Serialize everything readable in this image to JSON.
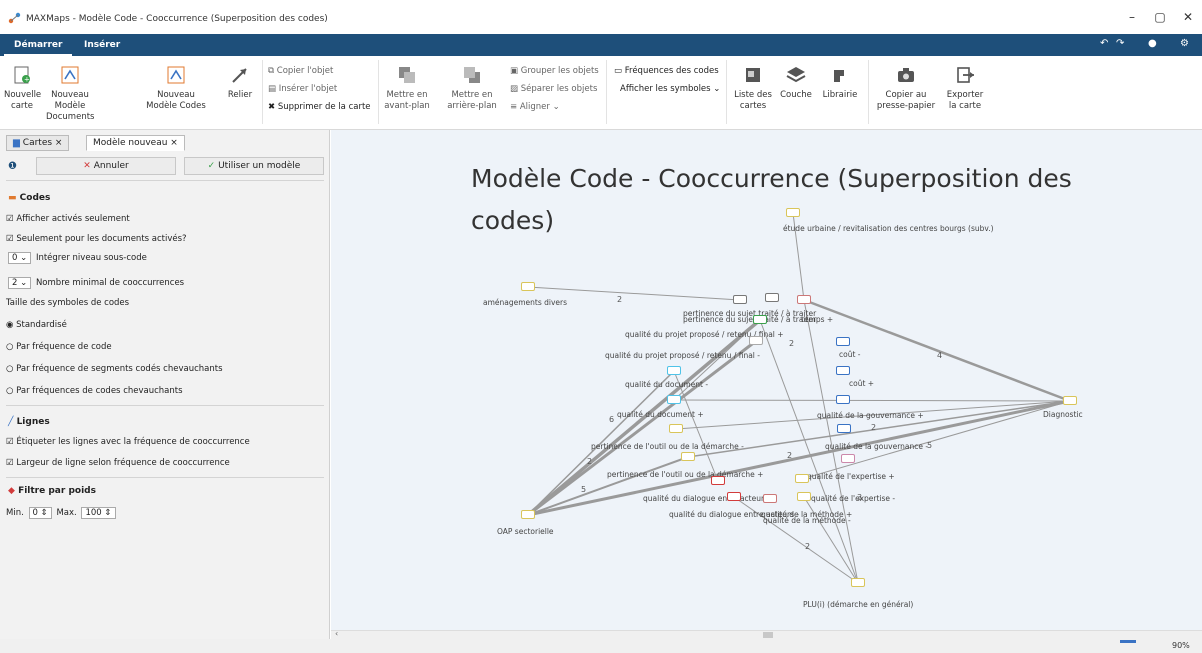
{
  "window": {
    "title": "MAXMaps - Modèle Code - Cooccurrence (Superposition des codes)",
    "minimize": "–",
    "maximize": "▢",
    "close": "✕"
  },
  "ribbon_tabs": [
    "Démarrer",
    "Insérer"
  ],
  "ribbon": {
    "nouvelle_carte": "Nouvelle carte",
    "nouveau_modele_documents": "Nouveau Modèle Documents",
    "nouveau_modele_codes": "Nouveau Modèle Codes",
    "relier": "Relier",
    "copier_objet": "Copier l'objet",
    "inserer_objet": "Insérer l'objet",
    "supprimer_carte": "Supprimer de la carte",
    "avant_plan": "Mettre en avant-plan",
    "arriere_plan": "Mettre en arrière-plan",
    "grouper": "Grouper les objets",
    "separer": "Séparer les objets",
    "aligner": "Aligner",
    "frequences_codes": "Fréquences des codes",
    "afficher_symboles": "Afficher les symboles",
    "liste_cartes": "Liste des cartes",
    "couche": "Couche",
    "librairie": "Librairie",
    "copier_presse": "Copier au presse-papier",
    "exporter": "Exporter la carte"
  },
  "panel": {
    "tab_cartes": "Cartes",
    "tab_modele": "Modèle nouveau",
    "annuler": "Annuler",
    "utiliser": "Utiliser un modèle",
    "codes_title": "Codes",
    "opt1": "Afficher activés seulement",
    "opt2": "Seulement pour les documents activés?",
    "integrer_val": "0",
    "integrer": "Intégrer niveau sous-code",
    "nombre_val": "2",
    "nombre": "Nombre minimal de cooccurrences",
    "taille": "Taille des symboles de codes",
    "r1": "Standardisé",
    "r2": "Par fréquence de code",
    "r3": "Par fréquence de segments codés chevauchants",
    "r4": "Par fréquences de codes chevauchants",
    "lignes_title": "Lignes",
    "l1": "Étiqueter les lignes avec la fréquence de cooccurrence",
    "l2": "Largeur de ligne selon fréquence de cooccurrence",
    "filtre_title": "Filtre par poids",
    "min_label": "Min.",
    "min_val": "0",
    "max_label": "Max.",
    "max_val": "100"
  },
  "map": {
    "title": "Modèle Code - Cooccurrence (Superposition des codes)",
    "nodes": [
      "étude urbaine / revitalisation des centres bourgs (subv.)",
      "aménagements divers",
      "pertinence du sujet traité / à traiter",
      "pertinence du sujet traité / à traiter",
      "temps +",
      "qualité du projet proposé / retenu / final +",
      "qualité du projet proposé / retenu / final -",
      "coût -",
      "coût +",
      "qualité du document -",
      "qualité du document +",
      "qualité de la gouvernance +",
      "Diagnostic",
      "pertinence de l'outil ou de la démarche -",
      "qualité de la gouvernance -",
      "pertinence de l'outil ou de la démarche +",
      "qualité de l'expertise +",
      "qualité du dialogue entre acteurs +",
      "qualité de l'expertise -",
      "qualité du dialogue entre acteurs -",
      "qualité de la méthode +",
      "qualité de la méthode -",
      "OAP sectorielle",
      "PLU(i) (démarche en général)"
    ],
    "edge_labels": [
      "2",
      "2",
      "4",
      "6",
      "2",
      "2",
      "5",
      "5",
      "3",
      "2",
      "2"
    ]
  },
  "status": {
    "zoom": "90%"
  }
}
